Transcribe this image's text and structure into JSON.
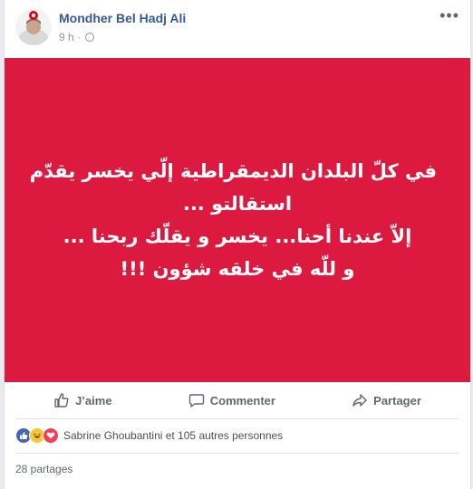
{
  "post": {
    "author": "Mondher Bel Hadj Ali",
    "time": "9 h",
    "meta_separator": "·",
    "message_lines": [
      "في كلّ البلدان الديمقراطية إلّي يخسر يقدّم",
      "استقالتو ...",
      "إلاّ عندنا أحنا... يخسر و يقلّك ربحنا ...",
      "و للّه في خلقه شؤون !!!"
    ],
    "card_color": "#dc1a3f"
  },
  "actions": {
    "like": "J’aime",
    "comment": "Commenter",
    "share": "Partager"
  },
  "reactions": {
    "text": "Sabrine Ghoubantini et 105 autres personnes",
    "icons": [
      "like-icon",
      "haha-icon",
      "love-icon"
    ]
  },
  "shares": {
    "text": "28 partages"
  },
  "icons": {
    "more": "more-options-icon",
    "privacy": "globe-icon"
  }
}
